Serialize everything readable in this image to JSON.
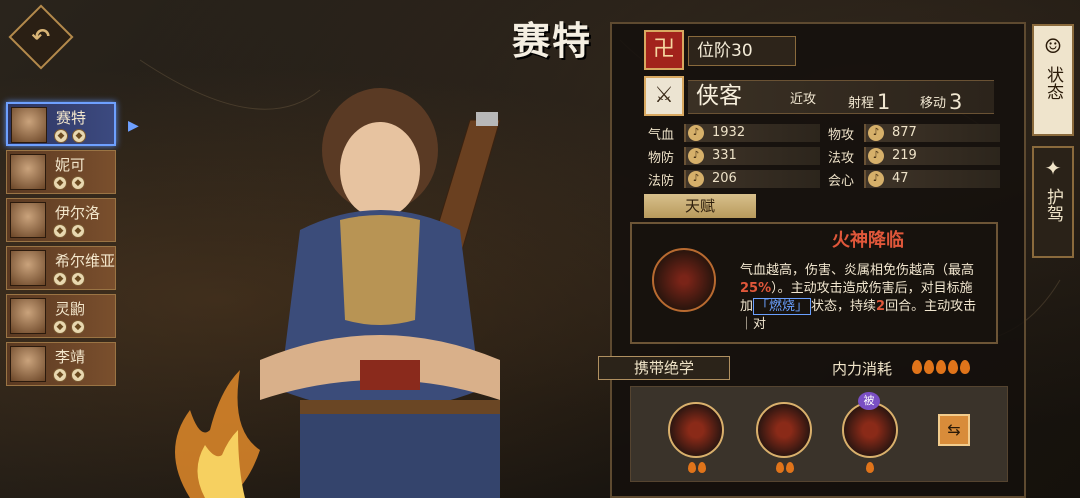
{
  "character": {
    "name": "赛特"
  },
  "roster": [
    {
      "name": "赛特",
      "active": true
    },
    {
      "name": "妮可",
      "active": false
    },
    {
      "name": "伊尔洛",
      "active": false
    },
    {
      "name": "希尔维亚",
      "active": false
    },
    {
      "name": "灵鼩",
      "active": false
    },
    {
      "name": "李靖",
      "active": false
    }
  ],
  "rank": {
    "label": "位阶30"
  },
  "class_info": {
    "name": "侠客",
    "attack_type": "近攻",
    "range_label": "射程",
    "range_value": "1",
    "move_label": "移动",
    "move_value": "3"
  },
  "stats": [
    {
      "label": "气血",
      "value": "1932"
    },
    {
      "label": "物攻",
      "value": "877"
    },
    {
      "label": "物防",
      "value": "331"
    },
    {
      "label": "法攻",
      "value": "219"
    },
    {
      "label": "法防",
      "value": "206"
    },
    {
      "label": "会心",
      "value": "47"
    }
  ],
  "talent": {
    "tab_label": "天赋",
    "title": "火神降临",
    "desc_1": "气血越高，伤害、炎属相免伤越高（最高",
    "desc_hl": "25%",
    "desc_2": "）。主动攻击造成伤害后，对目标施加",
    "desc_burn": "「燃烧」",
    "desc_3": "状态，持续",
    "desc_turns": "2",
    "desc_4": "回合。主动攻击｜对"
  },
  "skills": {
    "tab_label": "携带绝学",
    "mp_label": "内力消耗",
    "mp_cost": 5,
    "passive_badge": "被",
    "slots": [
      {
        "name": "skill-1",
        "cost": 2
      },
      {
        "name": "skill-2",
        "cost": 2
      },
      {
        "name": "skill-3",
        "cost": 1
      }
    ]
  },
  "side_tabs": [
    {
      "label": "状态",
      "active": true
    },
    {
      "label": "护驾",
      "active": false
    }
  ]
}
